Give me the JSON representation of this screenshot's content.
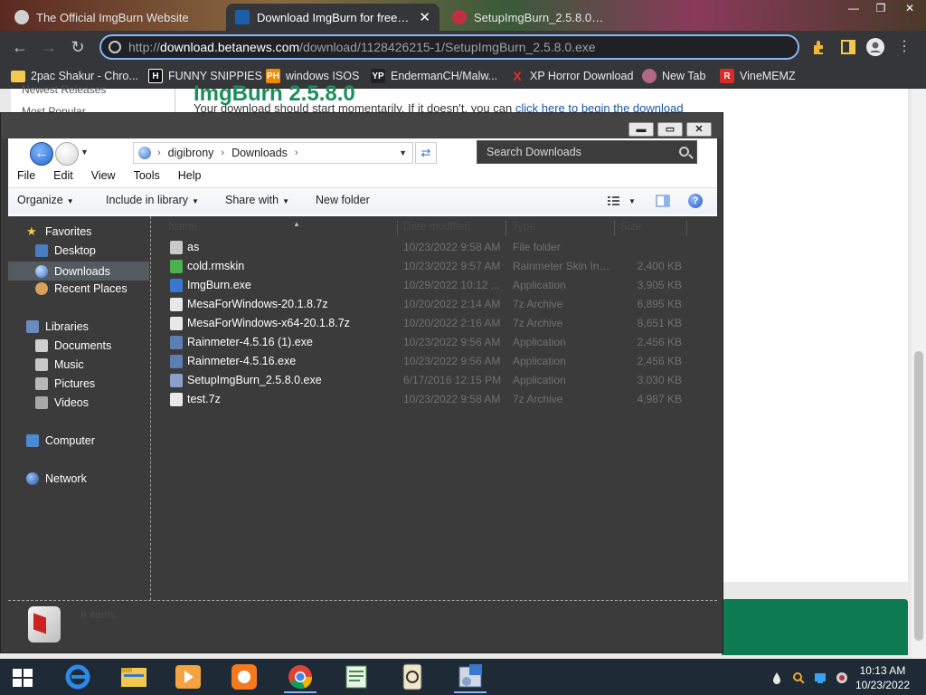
{
  "browser": {
    "tabs": [
      {
        "label": "The Official ImgBurn Website"
      },
      {
        "label": "Download ImgBurn for free | File"
      },
      {
        "label": "SetupImgBurn_2.5.8.0.exe"
      }
    ],
    "url_prefix": "http://",
    "url_host": "download.betanews.com",
    "url_path": "/download/1128426215-1/SetupImgBurn_2.5.8.0.exe",
    "bookmarks": [
      {
        "label": "2pac Shakur - Chro...",
        "icon": "folder-icon"
      },
      {
        "label": "FUNNY SNIPPIES",
        "icon": "H",
        "color": "#111111"
      },
      {
        "label": "windows ISOS",
        "icon": "PH",
        "color": "#f08a00"
      },
      {
        "label": "EndermanCH/Malw...",
        "icon": "YP",
        "color": "#222222"
      },
      {
        "label": "XP Horror Download",
        "icon": "X",
        "color": "#e0302a"
      },
      {
        "label": "New Tab",
        "icon": "globe",
        "color": "#b06a80"
      },
      {
        "label": "VineMEMZ",
        "icon": "R",
        "color": "#d92a2a"
      }
    ]
  },
  "webpage": {
    "sidebar": [
      "Newest Releases",
      "Most Popular"
    ],
    "heading": "ImgBurn 2.5.8.0",
    "line_text": "Your download should start momentarily. If it doesn't, you can ",
    "line_link": "click here to begin the download"
  },
  "explorer": {
    "breadcrumb": [
      "digibrony",
      "Downloads"
    ],
    "search_placeholder": "Search Downloads",
    "menu": [
      "File",
      "Edit",
      "View",
      "Tools",
      "Help"
    ],
    "commands": {
      "organize": "Organize",
      "include": "Include in library",
      "share": "Share with",
      "new_folder": "New folder"
    },
    "nav": {
      "favorites": "Favorites",
      "desktop": "Desktop",
      "downloads": "Downloads",
      "recent": "Recent Places",
      "libraries": "Libraries",
      "documents": "Documents",
      "music": "Music",
      "pictures": "Pictures",
      "videos": "Videos",
      "computer": "Computer",
      "network": "Network"
    },
    "columns": {
      "name": "Name",
      "date": "Date modified",
      "type": "Type",
      "size": "Size"
    },
    "files": [
      {
        "name": "as",
        "date": "10/23/2022 9:58 AM",
        "type": "File folder",
        "size": "",
        "icon": "folder-icon",
        "color": "#c9c9c9"
      },
      {
        "name": "cold.rmskin",
        "date": "10/23/2022 9:57 AM",
        "type": "Rainmeter Skin Ins...",
        "size": "2,400 KB",
        "icon": "droplet-icon",
        "color": "#4caf50"
      },
      {
        "name": "ImgBurn.exe",
        "date": "10/29/2022 10:12 ...",
        "type": "Application",
        "size": "3,905 KB",
        "icon": "app-icon",
        "color": "#3a78d0"
      },
      {
        "name": "MesaForWindows-20.1.8.7z",
        "date": "10/20/2022 2:14 AM",
        "type": "7z Archive",
        "size": "6,895 KB",
        "icon": "archive-icon",
        "color": "#e8e8e8"
      },
      {
        "name": "MesaForWindows-x64-20.1.8.7z",
        "date": "10/20/2022 2:16 AM",
        "type": "7z Archive",
        "size": "8,651 KB",
        "icon": "archive-icon",
        "color": "#e8e8e8"
      },
      {
        "name": "Rainmeter-4.5.16 (1).exe",
        "date": "10/23/2022 9:56 AM",
        "type": "Application",
        "size": "2,456 KB",
        "icon": "app-icon",
        "color": "#5a7fb0"
      },
      {
        "name": "Rainmeter-4.5.16.exe",
        "date": "10/23/2022 9:56 AM",
        "type": "Application",
        "size": "2,456 KB",
        "icon": "app-icon",
        "color": "#5a7fb0"
      },
      {
        "name": "SetupImgBurn_2.5.8.0.exe",
        "date": "6/17/2016 12:15 PM",
        "type": "Application",
        "size": "3,030 KB",
        "icon": "disc-icon",
        "color": "#8aa0c8"
      },
      {
        "name": "test.7z",
        "date": "10/23/2022 9:58 AM",
        "type": "7z Archive",
        "size": "4,987 KB",
        "icon": "archive-icon",
        "color": "#e8e8e8"
      }
    ],
    "details_text": "9 items"
  },
  "taskbar": {
    "apps": [
      "internet-explorer-icon",
      "file-explorer-icon",
      "media-player-icon",
      "uc-browser-icon",
      "chrome-icon",
      "notepad-icon",
      "clock-app-icon",
      "setup-icon"
    ],
    "time": "10:13 AM",
    "date": "10/23/2022"
  }
}
